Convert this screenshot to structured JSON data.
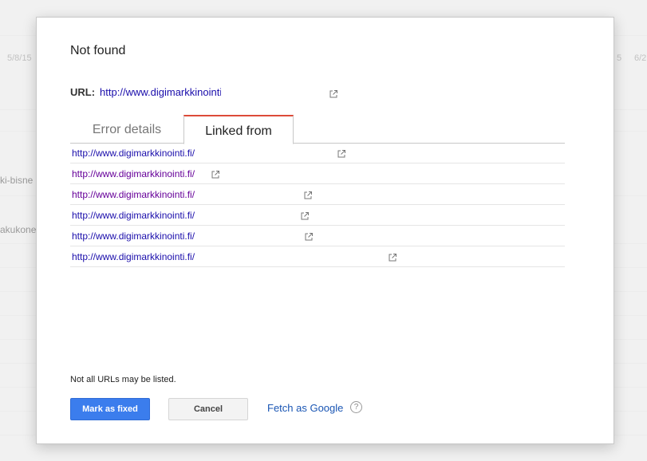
{
  "background": {
    "date_left": "5/8/15",
    "date_right_a": "5",
    "date_right_b": "6/2",
    "snippet_1": "ki-bisne",
    "snippet_2": "akukone"
  },
  "dialog": {
    "title": "Not found",
    "url_label": "URL:",
    "url_value": "http://www.digimarkkinointi.",
    "tabs": [
      {
        "label": "Error details",
        "active": false
      },
      {
        "label": "Linked from",
        "active": true
      }
    ],
    "linked_rows": [
      {
        "url": "http://www.digimarkkinointi.fi/",
        "visited": false
      },
      {
        "url": "http://www.digimarkkinointi.fi/",
        "visited": true
      },
      {
        "url": "http://www.digimarkkinointi.fi/",
        "visited": true
      },
      {
        "url": "http://www.digimarkkinointi.fi/",
        "visited": false
      },
      {
        "url": "http://www.digimarkkinointi.fi/",
        "visited": false
      },
      {
        "url": "http://www.digimarkkinointi.fi/",
        "visited": false
      }
    ],
    "note": "Not all URLs may be listed.",
    "mark_fixed_label": "Mark as fixed",
    "cancel_label": "Cancel",
    "fetch_label": "Fetch as Google",
    "help_glyph": "?",
    "external_link_icon": "external-link-icon"
  },
  "colors": {
    "accent_tab": "#dd4b39",
    "primary_button": "#3b7ded",
    "link": "#1a0dab",
    "visited_link": "#660099"
  }
}
